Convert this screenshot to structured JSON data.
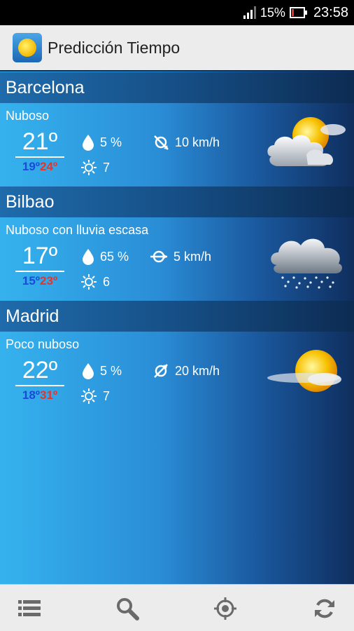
{
  "status_bar": {
    "battery": "15%",
    "time": "23:58"
  },
  "app": {
    "title": "Predicción Tiempo",
    "icon": "sun-app-icon"
  },
  "cities": [
    {
      "name": "Barcelona",
      "condition": "Nuboso",
      "temp": "21º",
      "min": "19º",
      "max": "24º",
      "rain": "5 %",
      "wind": "10 km/h",
      "uv": "7",
      "weather_icon": "partly-cloudy-icon"
    },
    {
      "name": "Bilbao",
      "condition": "Nuboso con lluvia escasa",
      "temp": "17º",
      "min": "15º",
      "max": "23º",
      "rain": "65 %",
      "wind": "5 km/h",
      "uv": "6",
      "weather_icon": "cloud-light-rain-icon"
    },
    {
      "name": "Madrid",
      "condition": "Poco nuboso",
      "temp": "22º",
      "min": "18º",
      "max": "31º",
      "rain": "5 %",
      "wind": "20 km/h",
      "uv": "7",
      "weather_icon": "mostly-sunny-icon"
    }
  ],
  "bottom_nav": [
    "menu-icon",
    "search-icon",
    "locate-icon",
    "refresh-icon"
  ],
  "colors": {
    "min_temp": "#1a4bd6",
    "max_temp": "#e8332a",
    "header": "#164f86"
  }
}
